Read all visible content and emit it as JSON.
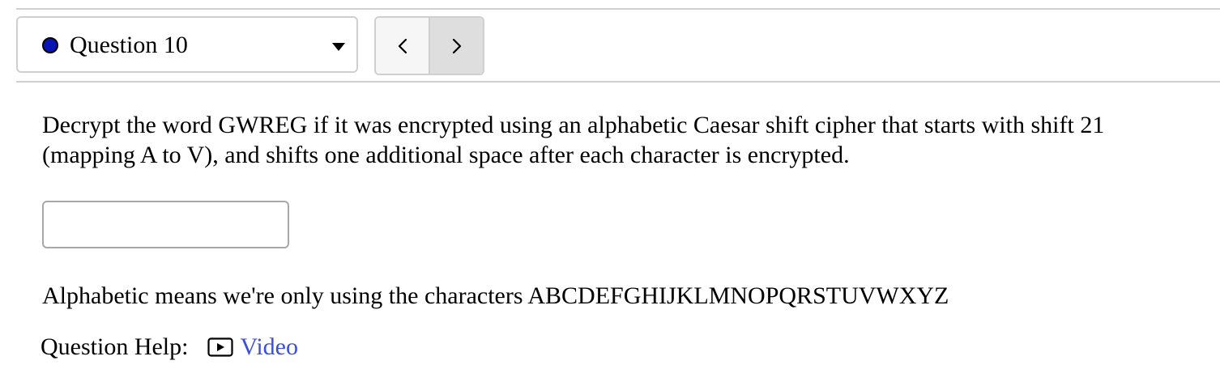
{
  "question_nav": {
    "selected_question": "Question 10",
    "status_color": "#0a14b4",
    "prev_icon": "chevron-left-icon",
    "next_icon": "chevron-right-icon"
  },
  "question": {
    "text": "Decrypt the word GWREG if it was encrypted using an alphabetic Caesar shift cipher that starts with shift 21 (mapping A to V), and shifts one additional space after each character is encrypted.",
    "answer_value": "",
    "note": "Alphabetic means we're only using the characters ABCDEFGHIJKLMNOPQRSTUVWXYZ"
  },
  "help": {
    "label": "Question Help:",
    "video_label": "Video",
    "video_icon": "play-icon",
    "link_color": "#3b4fd8"
  }
}
